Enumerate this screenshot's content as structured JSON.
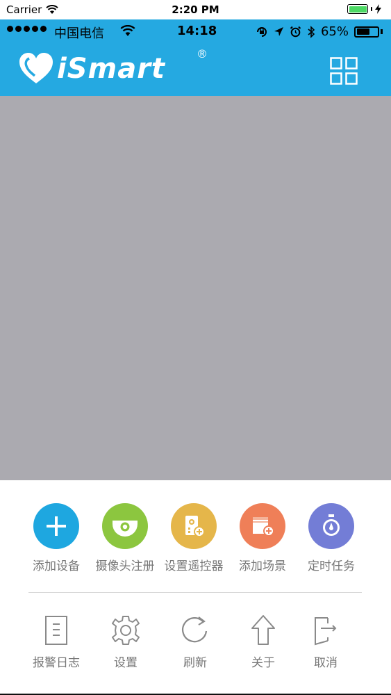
{
  "sim_status": {
    "carrier": "Carrier",
    "time": "2:20 PM",
    "battery_color": "#4cd964"
  },
  "app_status": {
    "carrier": "中国电信",
    "time": "14:18",
    "battery": "65%"
  },
  "header": {
    "logo_text": "iSmart",
    "registered_mark": "®",
    "brand_color": "#25a9e1",
    "menu_icon": "grid-icon"
  },
  "content": {
    "background": "#abaab0"
  },
  "actions": [
    {
      "label": "添加设备",
      "icon": "plus-icon",
      "color": "#1ea7e0"
    },
    {
      "label": "摄像头注册",
      "icon": "camera-icon",
      "color": "#8cc63f"
    },
    {
      "label": "设置遥控器",
      "icon": "remote-control-icon",
      "color": "#e5b64a"
    },
    {
      "label": "添加场景",
      "icon": "scene-add-icon",
      "color": "#ef7f58"
    },
    {
      "label": "定时任务",
      "icon": "timer-icon",
      "color": "#737dd6"
    }
  ],
  "secondary": [
    {
      "label": "报警日志",
      "icon": "document-icon"
    },
    {
      "label": "设置",
      "icon": "gear-icon"
    },
    {
      "label": "刷新",
      "icon": "refresh-icon"
    },
    {
      "label": "关于",
      "icon": "arrow-up-icon"
    },
    {
      "label": "取消",
      "icon": "exit-icon"
    }
  ]
}
